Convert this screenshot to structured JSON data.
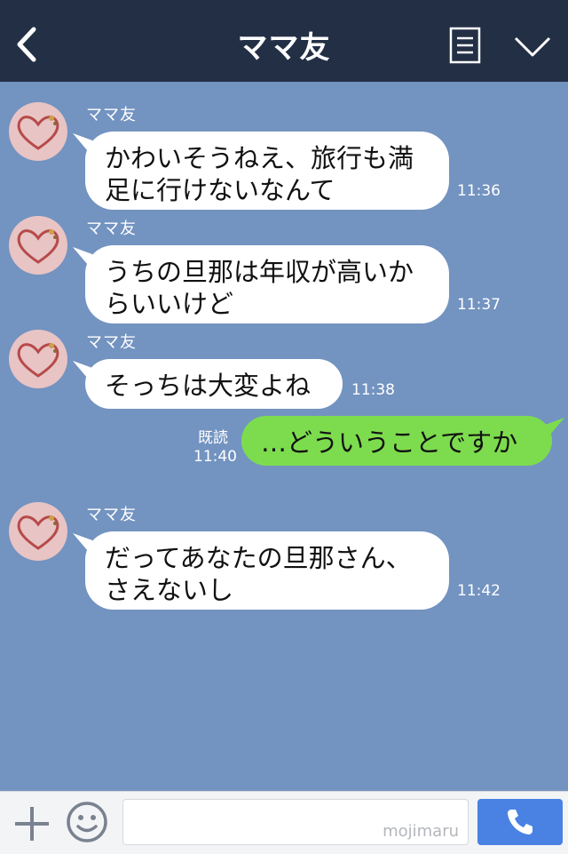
{
  "header": {
    "title": "ママ友"
  },
  "messages": [
    {
      "sender": "ママ友",
      "line1": "かわいそうねえ、旅行も満",
      "line2": "足に行けないなんて",
      "time": "11:36"
    },
    {
      "sender": "ママ友",
      "line1": "うちの旦那は年収が高いか",
      "line2": "らいいけど",
      "time": "11:37"
    },
    {
      "sender": "ママ友",
      "line1": "そっちは大変よね",
      "time": "11:38"
    },
    {
      "outgoing": true,
      "read": "既読",
      "line1": "…どういうことですか",
      "time": "11:40"
    },
    {
      "sender": "ママ友",
      "line1": "だってあなたの旦那さん、",
      "line2": "さえないし",
      "time": "11:42"
    }
  ],
  "footer": {
    "watermark": "mojimaru"
  }
}
